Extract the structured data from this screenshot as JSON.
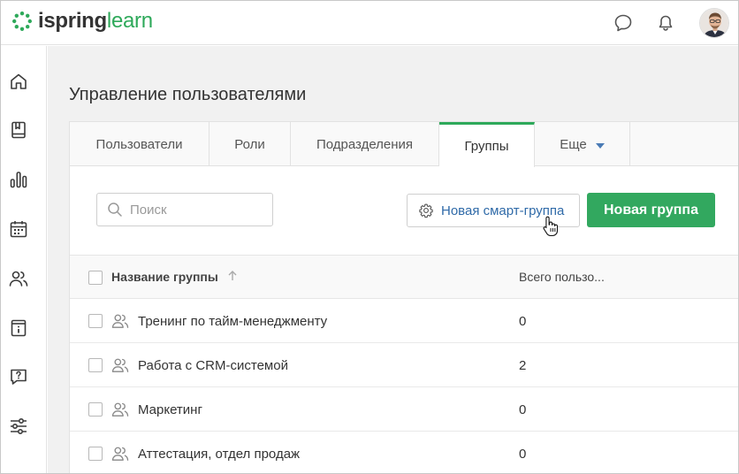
{
  "app": {
    "logo_primary": "ispring",
    "logo_secondary": "learn",
    "brand_color": "#2ea95a"
  },
  "header": {
    "icons": [
      "chat-icon",
      "bell-icon"
    ]
  },
  "sidebar": {
    "items": [
      {
        "icon": "home-icon"
      },
      {
        "icon": "book-icon"
      },
      {
        "icon": "bar-chart-icon"
      },
      {
        "icon": "calendar-icon"
      },
      {
        "icon": "users-icon"
      },
      {
        "icon": "info-book-icon"
      },
      {
        "icon": "question-icon"
      },
      {
        "icon": "sliders-icon"
      }
    ]
  },
  "page": {
    "title": "Управление пользователями"
  },
  "tabs": [
    {
      "label": "Пользователи",
      "active": false
    },
    {
      "label": "Роли",
      "active": false
    },
    {
      "label": "Подразделения",
      "active": false
    },
    {
      "label": "Группы",
      "active": true
    },
    {
      "label": "Еще",
      "active": false
    }
  ],
  "toolbar": {
    "search_placeholder": "Поиск",
    "smart_group_label": "Новая смарт-группа",
    "new_group_label": "Новая группа"
  },
  "table": {
    "columns": [
      "Название группы",
      "Всего пользо..."
    ],
    "rows": [
      {
        "name": "Тренинг по тайм-менеджменту",
        "count": "0"
      },
      {
        "name": "Работа с CRM-системой",
        "count": "2"
      },
      {
        "name": "Маркетинг",
        "count": "0"
      },
      {
        "name": "Аттестация, отдел продаж",
        "count": "0"
      }
    ]
  }
}
